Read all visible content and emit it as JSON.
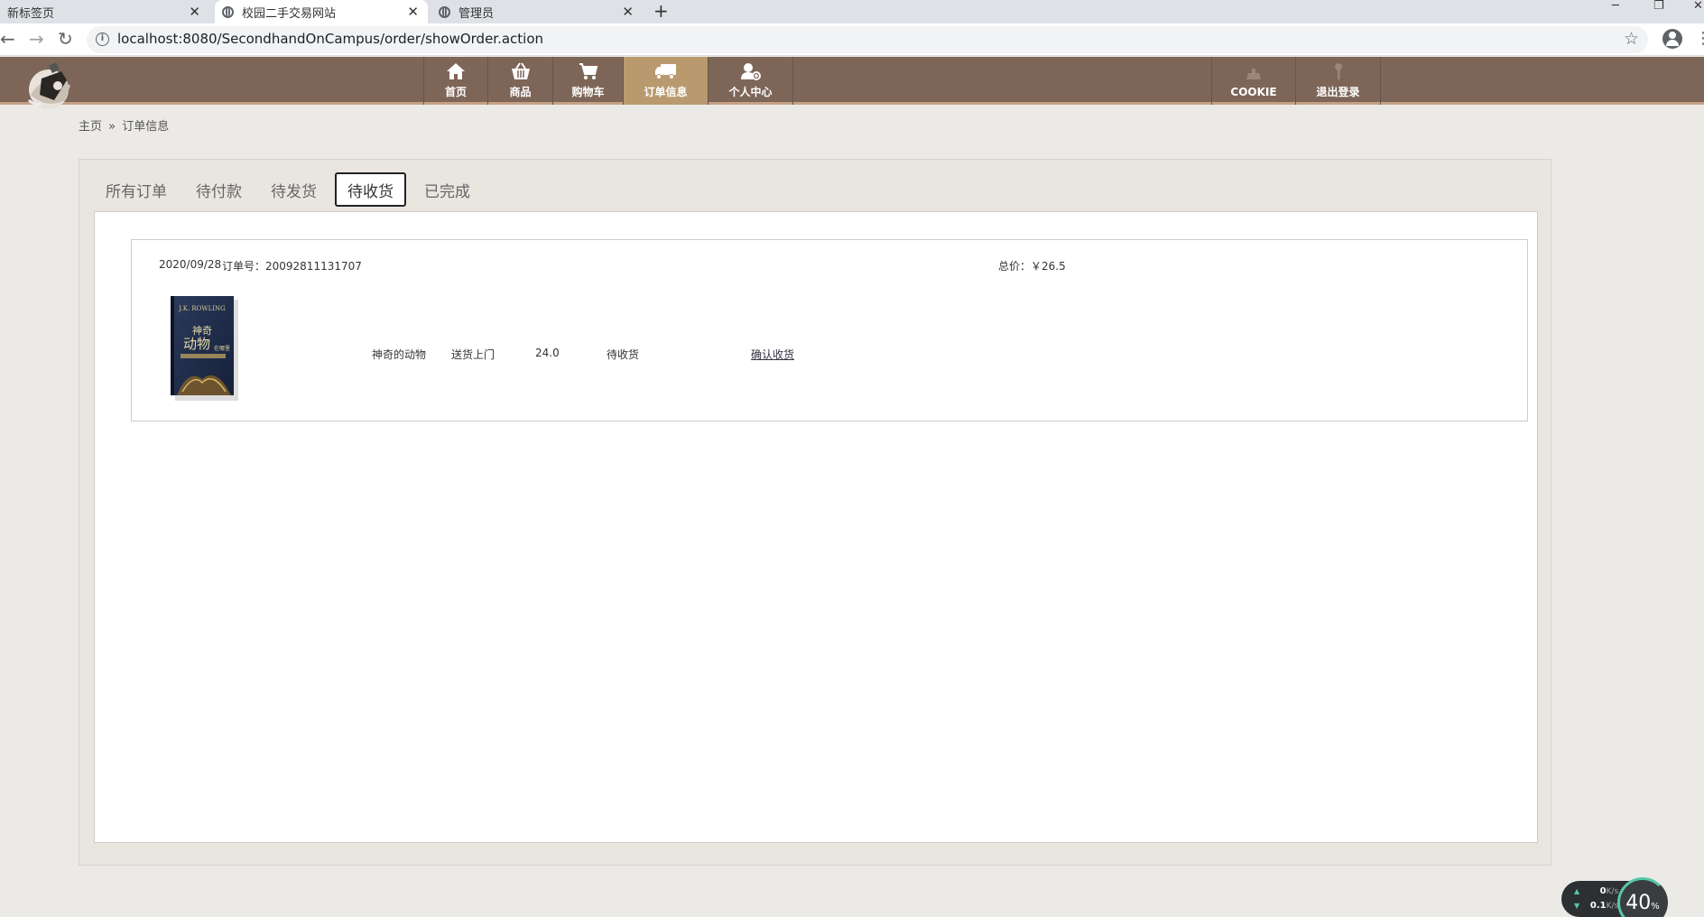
{
  "browser": {
    "tabs": [
      {
        "title": "新标签页"
      },
      {
        "title": "校园二手交易网站"
      },
      {
        "title": "管理员"
      }
    ],
    "url": "localhost:8080/SecondhandOnCampus/order/showOrder.action"
  },
  "nav": {
    "items": [
      {
        "label": "首页",
        "icon": "home-icon"
      },
      {
        "label": "商品",
        "icon": "basket-icon"
      },
      {
        "label": "购物车",
        "icon": "cart-icon"
      },
      {
        "label": "订单信息",
        "icon": "truck-icon"
      },
      {
        "label": "个人中心",
        "icon": "user-icon"
      }
    ],
    "right_items": [
      {
        "label": "COOKIE",
        "icon": "cookie-icon"
      },
      {
        "label": "退出登录",
        "icon": "key-icon"
      }
    ],
    "active": "订单信息",
    "colors": {
      "bar": "#7d6558",
      "active": "#b99a6f"
    }
  },
  "breadcrumb": {
    "home": "主页",
    "sep": "»",
    "current": "订单信息"
  },
  "order_tabs": [
    "所有订单",
    "待付款",
    "待发货",
    "待收货",
    "已完成"
  ],
  "active_tab": "待收货",
  "order": {
    "date": "2020/09/28",
    "number_label": "订单号：20092811131707",
    "total_label": "总价：￥26.5",
    "item": {
      "name": "神奇的动物",
      "delivery": "送货上门",
      "price": "24.0",
      "status": "待收货",
      "action": "确认收货",
      "cover_text_1": "J.K. ROWLING",
      "cover_text_2": "神奇",
      "cover_text_3": "动物",
      "cover_text_4": "在哪里"
    }
  },
  "netwidget": {
    "up": "0",
    "down": "0.1",
    "unit": "K/s",
    "percent": "40",
    "percent_sign": "%"
  }
}
